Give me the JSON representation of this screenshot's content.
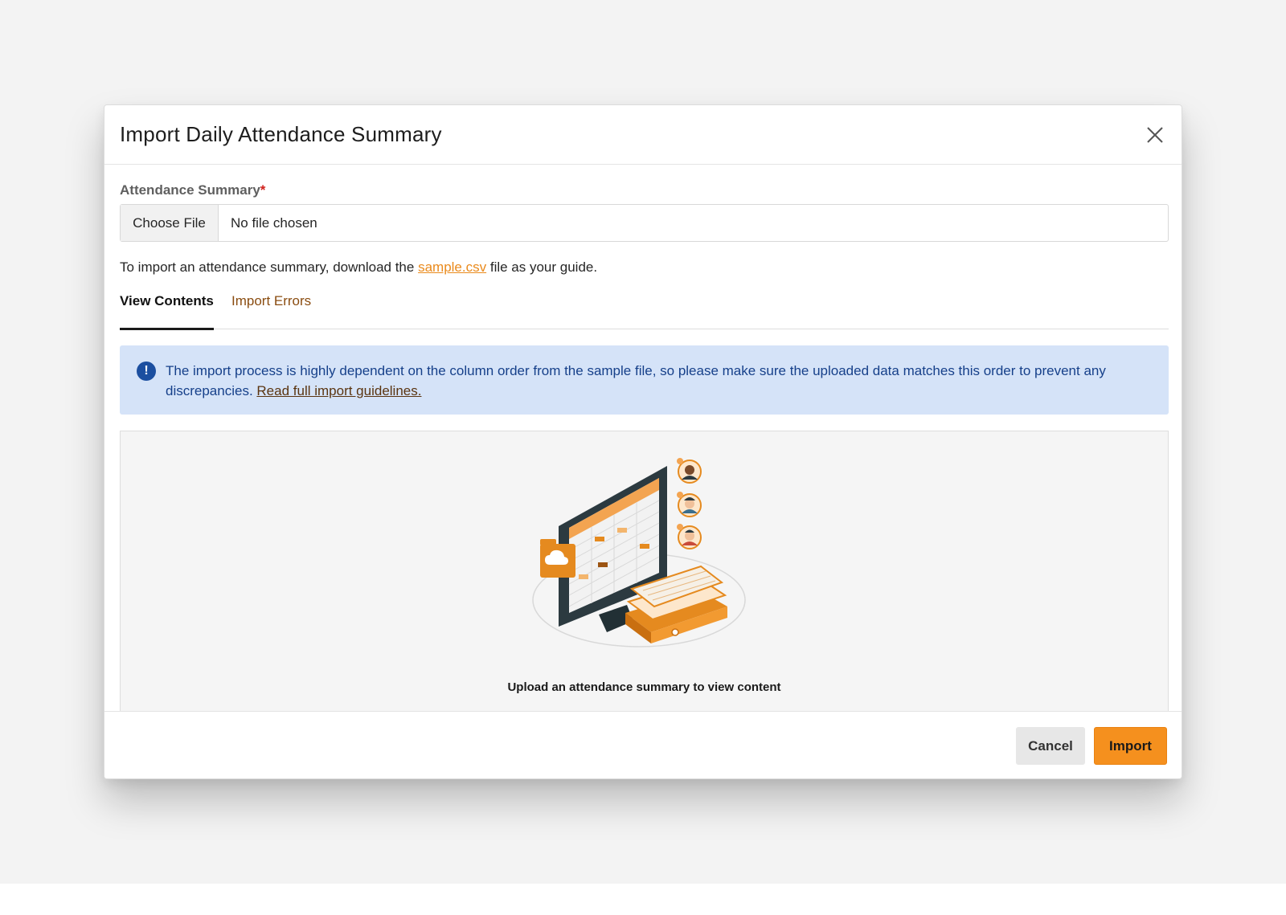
{
  "modal": {
    "title": "Import Daily Attendance Summary",
    "close_icon": "close-icon"
  },
  "form": {
    "label": "Attendance Summary",
    "required_marker": "*",
    "choose_file_label": "Choose File",
    "file_status": "No file chosen",
    "guide_prefix": "To import an attendance summary, download the",
    "guide_link": "sample.csv",
    "guide_suffix": "file as your guide."
  },
  "tabs": [
    {
      "label": "View Contents",
      "active": true
    },
    {
      "label": "Import Errors",
      "active": false
    }
  ],
  "alert": {
    "icon": "info-icon",
    "text": "The import process is highly dependent on the column order from the sample file, so please make sure the uploaded data matches this order to prevent any discrepancies.",
    "link": "Read full import guidelines."
  },
  "preview": {
    "caption": "Upload an attendance summary to view content",
    "illustration": "upload-attendance-illustration"
  },
  "footer": {
    "cancel_label": "Cancel",
    "import_label": "Import"
  },
  "colors": {
    "accent": "#f5901e",
    "link": "#ea8a1c",
    "alert_bg": "#d5e3f8",
    "alert_text": "#16408a"
  }
}
